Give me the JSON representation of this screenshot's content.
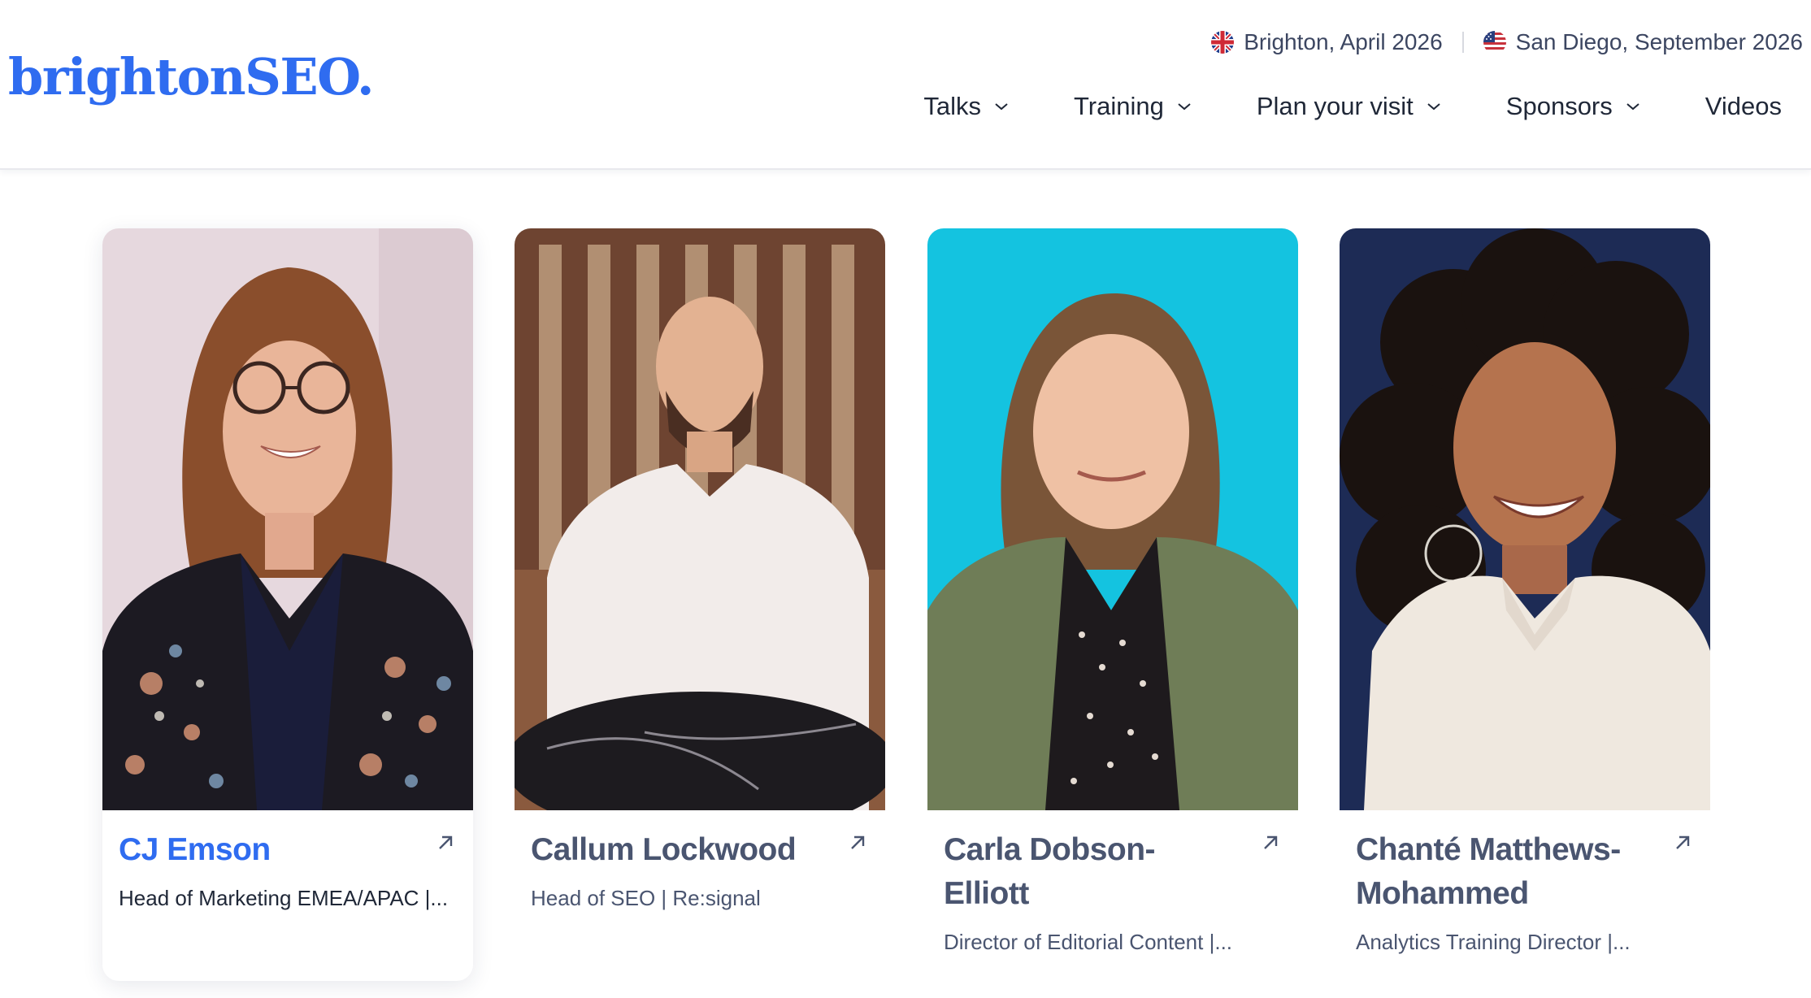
{
  "site": {
    "logo_text": "brightonSEO.",
    "brand_color": "#2f6cf0"
  },
  "events": [
    {
      "label": "Brighton, April 2026",
      "flag": "uk-flag-icon"
    },
    {
      "label": "San Diego, September 2026",
      "flag": "us-flag-icon"
    }
  ],
  "nav": {
    "items": [
      {
        "label": "Talks",
        "has_dropdown": true
      },
      {
        "label": "Training",
        "has_dropdown": true
      },
      {
        "label": "Plan your visit",
        "has_dropdown": true
      },
      {
        "label": "Sponsors",
        "has_dropdown": true
      },
      {
        "label": "Videos",
        "has_dropdown": false
      }
    ]
  },
  "speakers": [
    {
      "name": "CJ Emson",
      "role": "Head of Marketing EMEA/APAC |...",
      "highlighted": true
    },
    {
      "name": "Callum Lockwood",
      "role": "Head of SEO | Re:signal",
      "highlighted": false
    },
    {
      "name": "Carla Dobson-Elliott",
      "role": "Director of Editorial Content |...",
      "highlighted": false
    },
    {
      "name": "Chanté Matthews-Mohammed",
      "role": "Analytics Training Director |...",
      "highlighted": false
    }
  ],
  "icons": {
    "card_link": "arrow-up-right-icon",
    "dropdown": "chevron-down-icon"
  }
}
